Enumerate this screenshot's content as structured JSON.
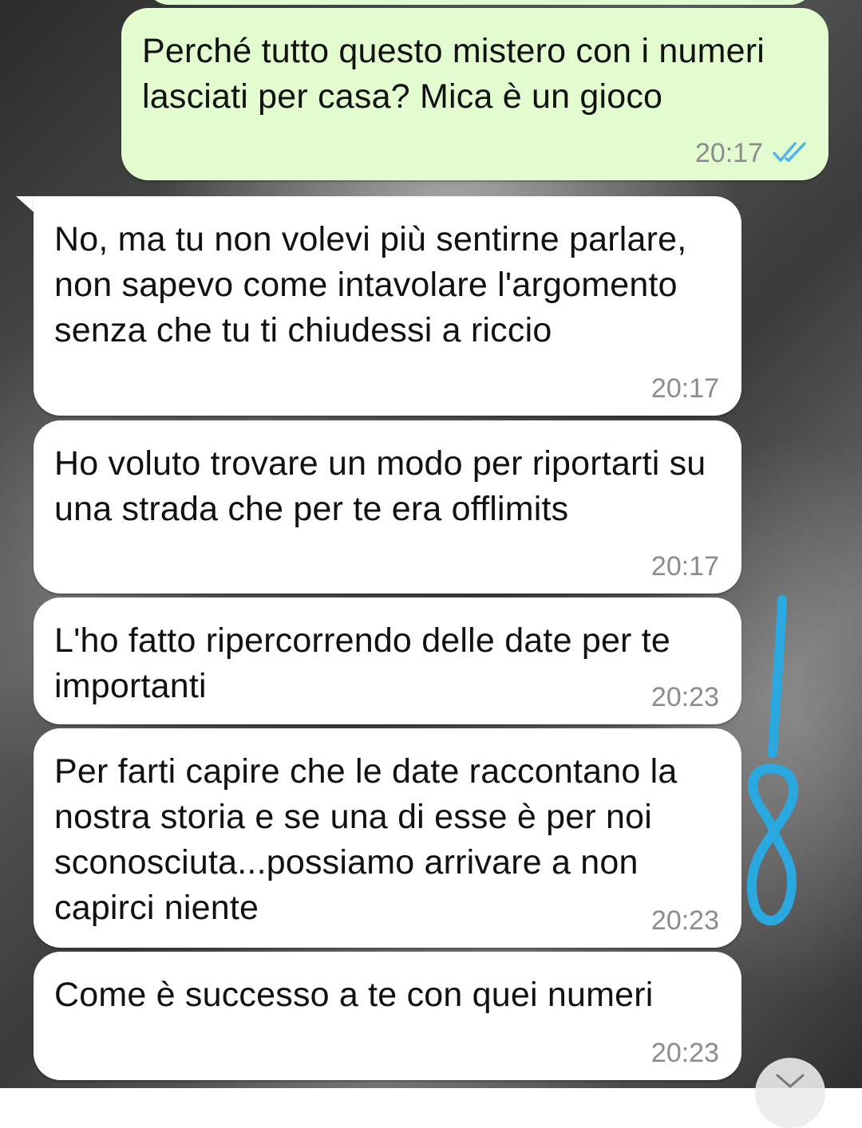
{
  "chat": {
    "messages": [
      {
        "direction": "outgoing",
        "text": "Perché tutto questo mistero con i numeri lasciati per casa? Mica è un gioco",
        "time": "20:17",
        "status": "read"
      },
      {
        "direction": "incoming",
        "text": "No, ma tu non volevi più sentirne parlare, non sapevo come intavolare l'argomento senza che tu ti chiudessi a riccio",
        "time": "20:17"
      },
      {
        "direction": "incoming",
        "text": "Ho voluto trovare un modo per riportarti su una strada che per te era offlimits",
        "time": "20:17"
      },
      {
        "direction": "incoming",
        "text": "L'ho fatto ripercorrendo delle date per te importanti",
        "time": "20:23"
      },
      {
        "direction": "incoming",
        "text": "Per farti capire che le date raccontano la nostra storia e se una di esse è per noi sconosciuta...possiamo arrivare a non capirci niente",
        "time": "20:23"
      },
      {
        "direction": "incoming",
        "text": "Come è successo a te con quei numeri",
        "time": "20:23"
      }
    ]
  },
  "colors": {
    "outgoing_bubble": "#e2fcd0",
    "incoming_bubble": "#ffffff",
    "read_ticks": "#4fb6ec",
    "annotation": "#29a9e0"
  },
  "icons": {
    "read_status": "double-check-icon",
    "scroll_down": "chevron-down-icon"
  }
}
